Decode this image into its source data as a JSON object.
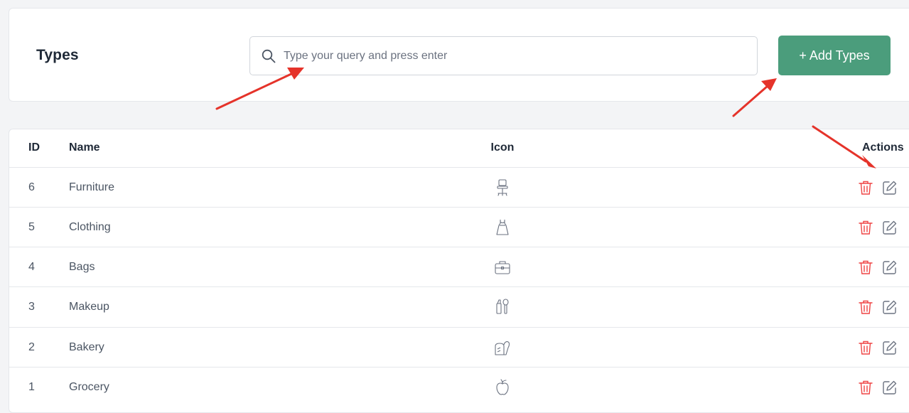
{
  "header": {
    "title": "Types",
    "search_placeholder": "Type your query and press enter",
    "add_button_label": "+ Add Types"
  },
  "table": {
    "columns": {
      "id": "ID",
      "name": "Name",
      "icon": "Icon",
      "actions": "Actions"
    },
    "rows": [
      {
        "id": "6",
        "name": "Furniture",
        "icon": "chair-icon"
      },
      {
        "id": "5",
        "name": "Clothing",
        "icon": "dress-icon"
      },
      {
        "id": "4",
        "name": "Bags",
        "icon": "briefcase-icon"
      },
      {
        "id": "3",
        "name": "Makeup",
        "icon": "makeup-icon"
      },
      {
        "id": "2",
        "name": "Bakery",
        "icon": "bread-icon"
      },
      {
        "id": "1",
        "name": "Grocery",
        "icon": "apple-icon"
      }
    ]
  },
  "colors": {
    "accent": "#4b9d7c",
    "delete": "#ef4444",
    "annotation_arrow": "#e5332a"
  }
}
